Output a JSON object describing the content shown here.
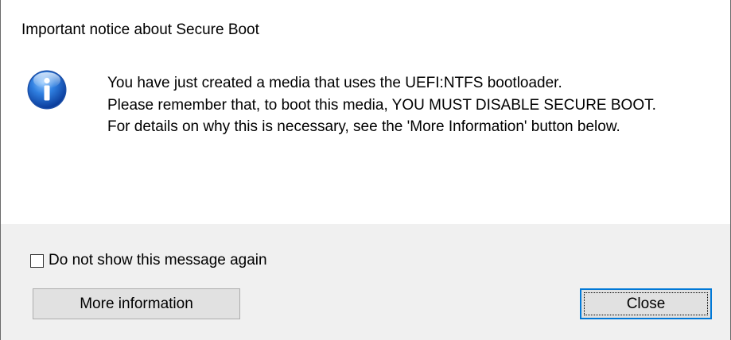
{
  "dialog": {
    "title": "Important notice about Secure Boot",
    "icon": "information-icon",
    "message_lines": [
      "You have just created a media that uses the UEFI:NTFS bootloader.",
      "Please remember that, to boot this media, YOU MUST DISABLE SECURE BOOT.",
      "For details on why this is necessary, see the 'More Information' button below."
    ]
  },
  "footer": {
    "checkbox_label": "Do not show this message again",
    "checkbox_checked": false,
    "more_info_label": "More information",
    "close_label": "Close"
  },
  "colors": {
    "accent": "#0078d7",
    "footer_bg": "#f0f0f0",
    "button_bg": "#e1e1e1"
  }
}
